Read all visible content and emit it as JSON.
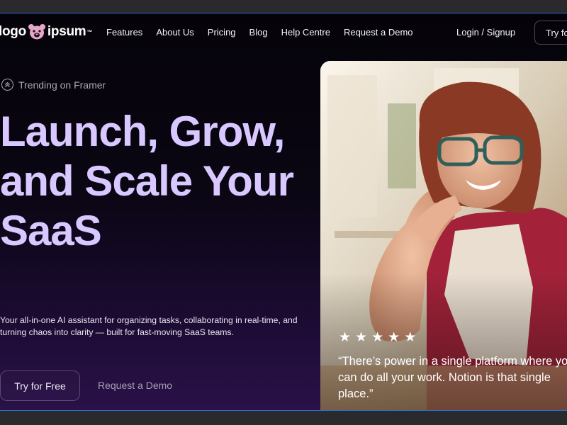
{
  "logo": {
    "left": "logo",
    "right": "ipsum",
    "mark": "™"
  },
  "nav": {
    "links": [
      "Features",
      "About Us",
      "Pricing",
      "Blog",
      "Help Centre",
      "Request a Demo"
    ],
    "login": "Login / Signup",
    "cta": "Try for Free"
  },
  "hero": {
    "badge": "Trending on Framer",
    "headline": "Launch, Grow, and Scale Your SaaS",
    "subtitle": "Your all-in-one AI assistant for organizing tasks, collaborating in real-time, and turning chaos into clarity — built for fast-moving SaaS teams.",
    "primary_button": "Try for Free",
    "secondary_button": "Request a Demo"
  },
  "testimonial": {
    "stars": 5,
    "quote": "“There’s power in a single platform where you can do all your work. Notion is that single place.”"
  },
  "colors": {
    "headline": "#d9c8ff",
    "frame_border": "#2d6fd6",
    "background_top": "#050309",
    "background_bottom": "#2a1148"
  },
  "icons": {
    "logo": "bear-icon",
    "badge": "chevron-up-circle-icon",
    "star": "star-icon"
  }
}
